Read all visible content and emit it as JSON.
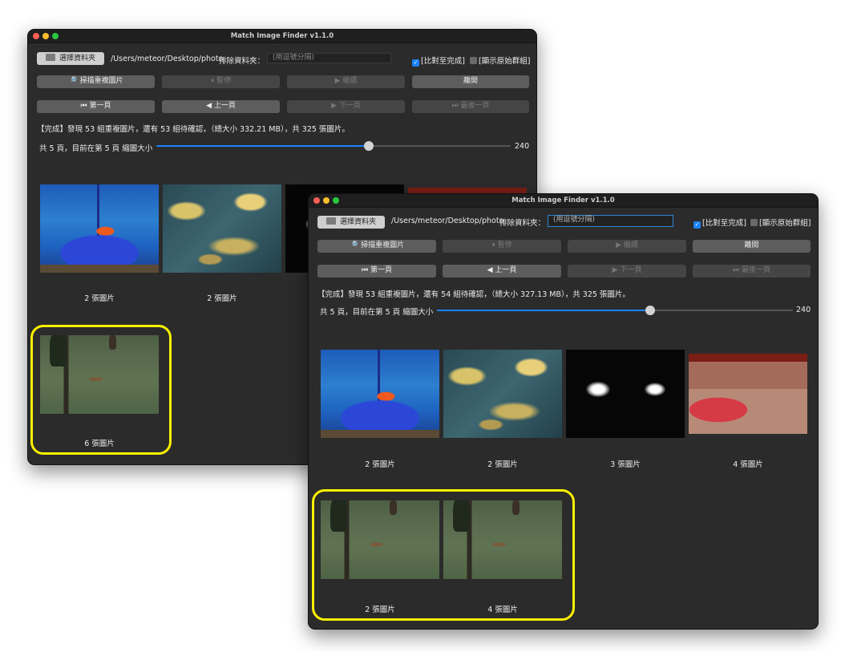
{
  "windows": [
    {
      "title": "Match Image Finder v1.1.0",
      "choose_folder": "選擇資料夾",
      "path": "/Users/meteor/Desktop/photo",
      "exclude_label": "排除資料夾：",
      "exclude_placeholder": "(用逗號分隔)",
      "compare_done": "[比對至完成]",
      "show_groups": "[顯示原始群組]",
      "btn_scan": "掃描重複圖片",
      "btn_pause": "⏸ 暫停",
      "btn_continue": "▶ 繼續",
      "btn_exit": "離開",
      "btn_first": "⏮ 第一頁",
      "btn_prev": "◀ 上一頁",
      "btn_next": "▶ 下一頁",
      "btn_last": "⏭ 最後一頁",
      "status": "【完成】發現 53 組重複圖片，還有 53 組待確認，（總大小 332.21 MB），共 325 張圖片。",
      "page_info": "共 5 頁，目前在第 5 頁 縮圖大小",
      "thumb_size": "240",
      "thumb_level": 0.6,
      "groups": [
        {
          "count": "2 張圖片",
          "image": "fish-tank"
        },
        {
          "count": "2 張圖片",
          "image": "coral"
        },
        {
          "count": "",
          "image": "lights"
        },
        {
          "count": "",
          "image": "crowd"
        },
        {
          "count": "6 張圖片",
          "image": "bird-on-grass"
        }
      ]
    },
    {
      "title": "Match Image Finder v1.1.0",
      "choose_folder": "選擇資料夾",
      "path": "/Users/meteor/Desktop/photo",
      "exclude_label": "排除資料夾：",
      "exclude_placeholder": "(用逗號分隔)",
      "compare_done": "[比對至完成]",
      "show_groups": "[顯示原始群組]",
      "btn_scan": "掃描重複圖片",
      "btn_pause": "⏸ 暫停",
      "btn_continue": "▶ 繼續",
      "btn_exit": "離開",
      "btn_first": "⏮ 第一頁",
      "btn_prev": "◀ 上一頁",
      "btn_next": "▶ 下一頁",
      "btn_last": "⏭ 最後一頁",
      "status": "【完成】發現 53 組重複圖片，還有 54 組待確認，（總大小 327.13 MB），共 325 張圖片。",
      "page_info": "共 5 頁，目前在第 5 頁 縮圖大小",
      "thumb_size": "240",
      "thumb_level": 0.6,
      "groups": [
        {
          "count": "2 張圖片",
          "image": "fish-tank"
        },
        {
          "count": "2 張圖片",
          "image": "coral"
        },
        {
          "count": "3 張圖片",
          "image": "lights"
        },
        {
          "count": "4 張圖片",
          "image": "crowd"
        },
        {
          "count": "2 張圖片",
          "image": "bird-on-grass"
        },
        {
          "count": "4 張圖片",
          "image": "bird-on-grass"
        }
      ]
    }
  ],
  "colors": {
    "accent": "#1a82ff",
    "highlight": "#fbf000",
    "window_bg": "#2b2b2b"
  }
}
